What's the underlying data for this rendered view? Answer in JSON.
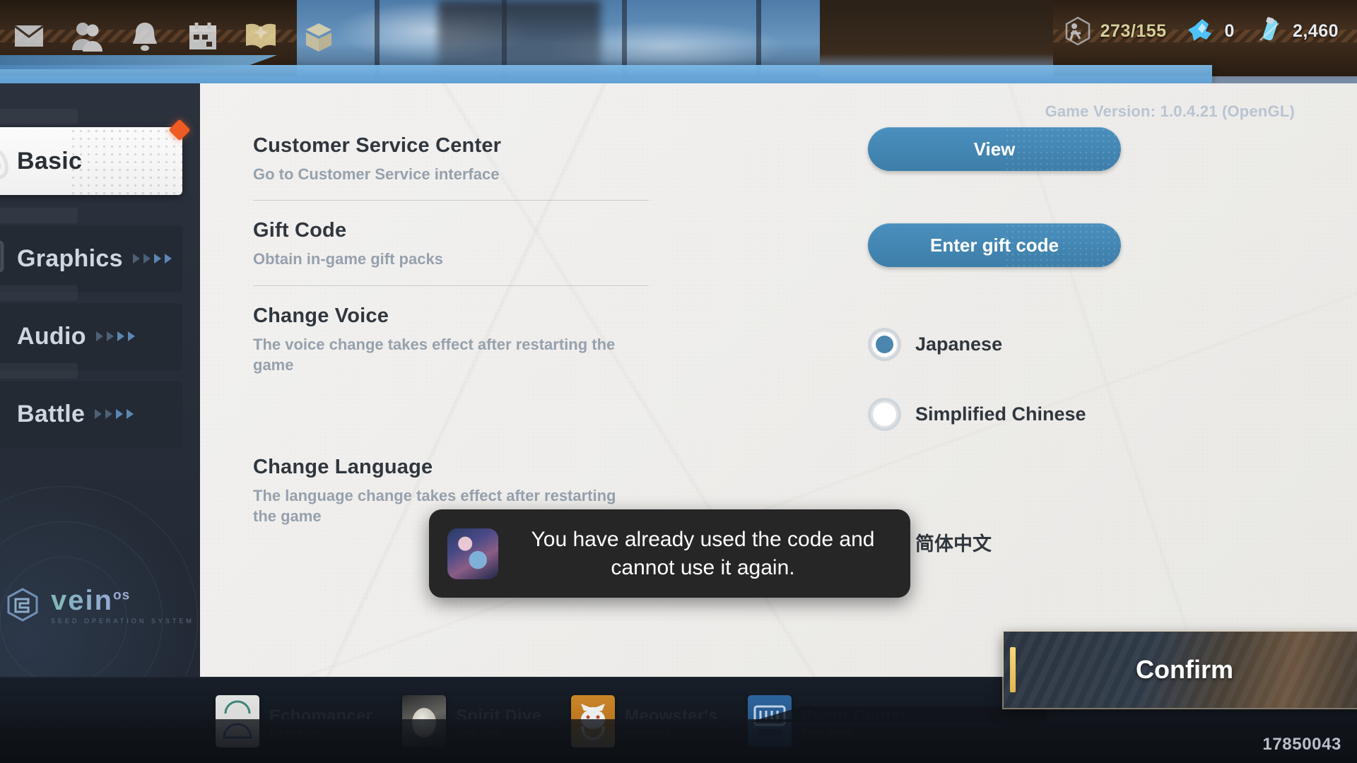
{
  "hud": {
    "icons": [
      {
        "name": "mail-icon",
        "label": "Mail"
      },
      {
        "name": "friends-icon",
        "label": "Friends"
      },
      {
        "name": "notification-bell-icon",
        "label": "Notifications"
      },
      {
        "name": "calendar-icon",
        "label": "Calendar"
      },
      {
        "name": "handbook-icon",
        "label": "Handbook"
      },
      {
        "name": "archive-icon",
        "label": "Archive"
      }
    ],
    "currencies": [
      {
        "name": "stamina",
        "icon": "stamina-icon",
        "value": "273/155"
      },
      {
        "name": "blue-crystal",
        "icon": "crystal-icon",
        "value": "0"
      },
      {
        "name": "energy-vial",
        "icon": "vial-icon",
        "value": "2,460"
      }
    ]
  },
  "sidebar": {
    "tabs": [
      {
        "label": "Basic",
        "icon": "gamepad-icon",
        "active": true,
        "badge": true
      },
      {
        "label": "Graphics",
        "icon": "display-icon",
        "active": false,
        "badge": false
      },
      {
        "label": "Audio",
        "icon": "speaker-icon",
        "active": false,
        "badge": false
      },
      {
        "label": "Battle",
        "icon": "sword-icon",
        "active": false,
        "badge": false
      }
    ],
    "logo": {
      "main": "vein",
      "sup": "os",
      "subtitle": "SEED OPERATION SYSTEM"
    }
  },
  "content": {
    "game_version": "Game Version: 1.0.4.21 (OpenGL)",
    "rows": [
      {
        "title": "Customer Service Center",
        "desc": "Go to Customer Service interface",
        "control": "button",
        "button_label": "View"
      },
      {
        "title": "Gift Code",
        "desc": "Obtain in-game gift packs",
        "control": "button",
        "button_label": "Enter gift code"
      },
      {
        "title": "Change Voice",
        "desc": "The voice change takes effect after restarting the game",
        "control": "radio",
        "options": [
          {
            "label": "Japanese",
            "selected": true
          },
          {
            "label": "Simplified Chinese",
            "selected": false
          }
        ]
      },
      {
        "title": "Change Language",
        "desc": "The language change takes effect after restarting the game",
        "control": "radio",
        "options": [
          {
            "label": "简体中文",
            "selected": false
          }
        ]
      }
    ]
  },
  "toast": {
    "message": "You have already used the code and cannot use it again.",
    "avatar": "character-avatar-icon"
  },
  "bottom_nav": [
    {
      "label": "Echomancer",
      "sub": "Echomancer",
      "icon": "echomancer-icon"
    },
    {
      "label": "Spirit Dive",
      "sub": "Spirit Dive",
      "icon": "spirit-dive-icon"
    },
    {
      "label": "Meowster's",
      "sub": "Meowster's",
      "icon": "meowsters-icon"
    },
    {
      "label": "Event Center",
      "sub": "Event Center",
      "icon": "event-center-icon"
    }
  ],
  "footer": {
    "confirm_label": "Confirm",
    "user_id": "17850043"
  },
  "colors": {
    "accent_blue": "#4a8fbd",
    "badge_red": "#f15a22",
    "confirm_accent": "#f6d77a",
    "panel_bg": "#f2f1ef",
    "sidebar_bg": "#2b323d"
  }
}
